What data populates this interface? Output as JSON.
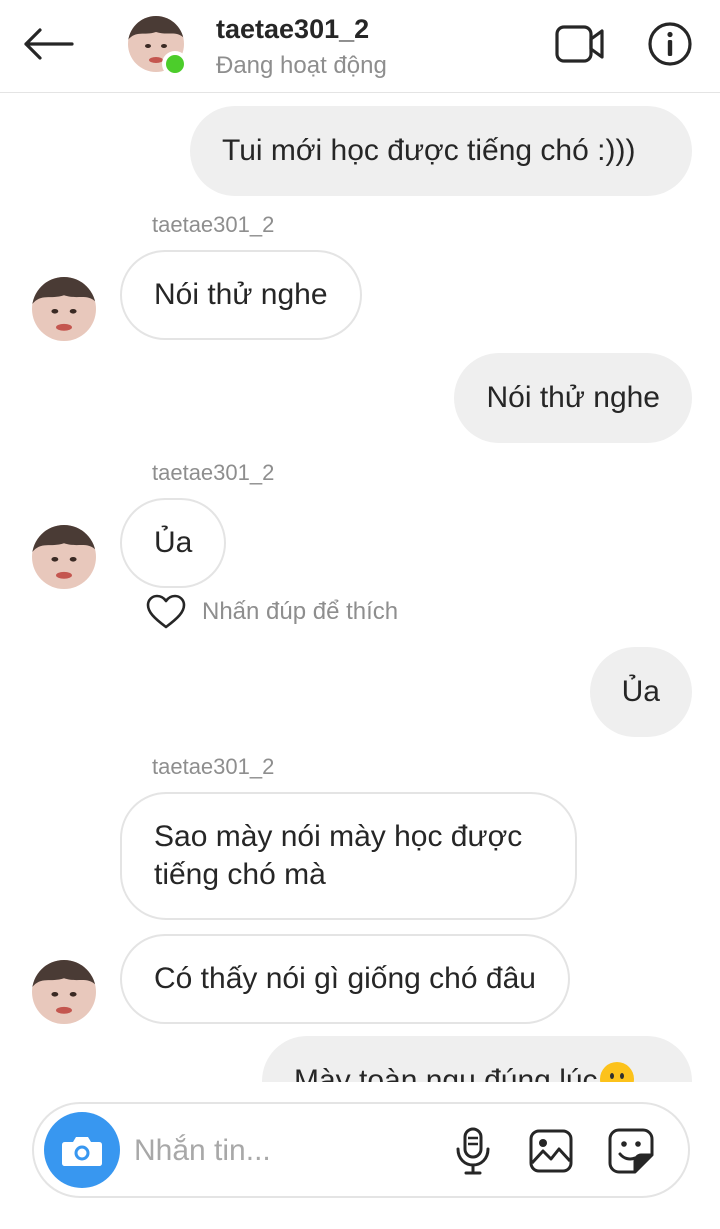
{
  "header": {
    "username": "taetae301_2",
    "status": "Đang hoạt động"
  },
  "messages": [
    {
      "direction": "out",
      "text": "Tui mới học được tiếng chó :)))"
    },
    {
      "direction": "in",
      "sender": "taetae301_2",
      "text": "Nói thử nghe"
    },
    {
      "direction": "out",
      "text": "Nói thử nghe"
    },
    {
      "direction": "in",
      "sender": "taetae301_2",
      "text": "Ủa",
      "hint": "Nhấn đúp để thích"
    },
    {
      "direction": "out",
      "text": "Ủa"
    },
    {
      "direction": "in",
      "sender": "taetae301_2",
      "text": "Sao mày nói mày học được tiếng chó mà"
    },
    {
      "direction": "in",
      "text": "Có thấy nói gì giống chó đâu"
    },
    {
      "direction": "out",
      "text": "Mày toàn ngu đúng lúc",
      "emoji": "slightly-smiling-face"
    }
  ],
  "composer": {
    "placeholder": "Nhắn tin..."
  },
  "colors": {
    "accent": "#3897f0",
    "online": "#4ccd2b",
    "outgoing_bubble": "#efefef",
    "muted_text": "#8e8e8e"
  },
  "icons": [
    "back-arrow-icon",
    "video-camera-icon",
    "info-icon",
    "heart-icon",
    "camera-icon",
    "microphone-icon",
    "gallery-icon",
    "sticker-icon"
  ]
}
